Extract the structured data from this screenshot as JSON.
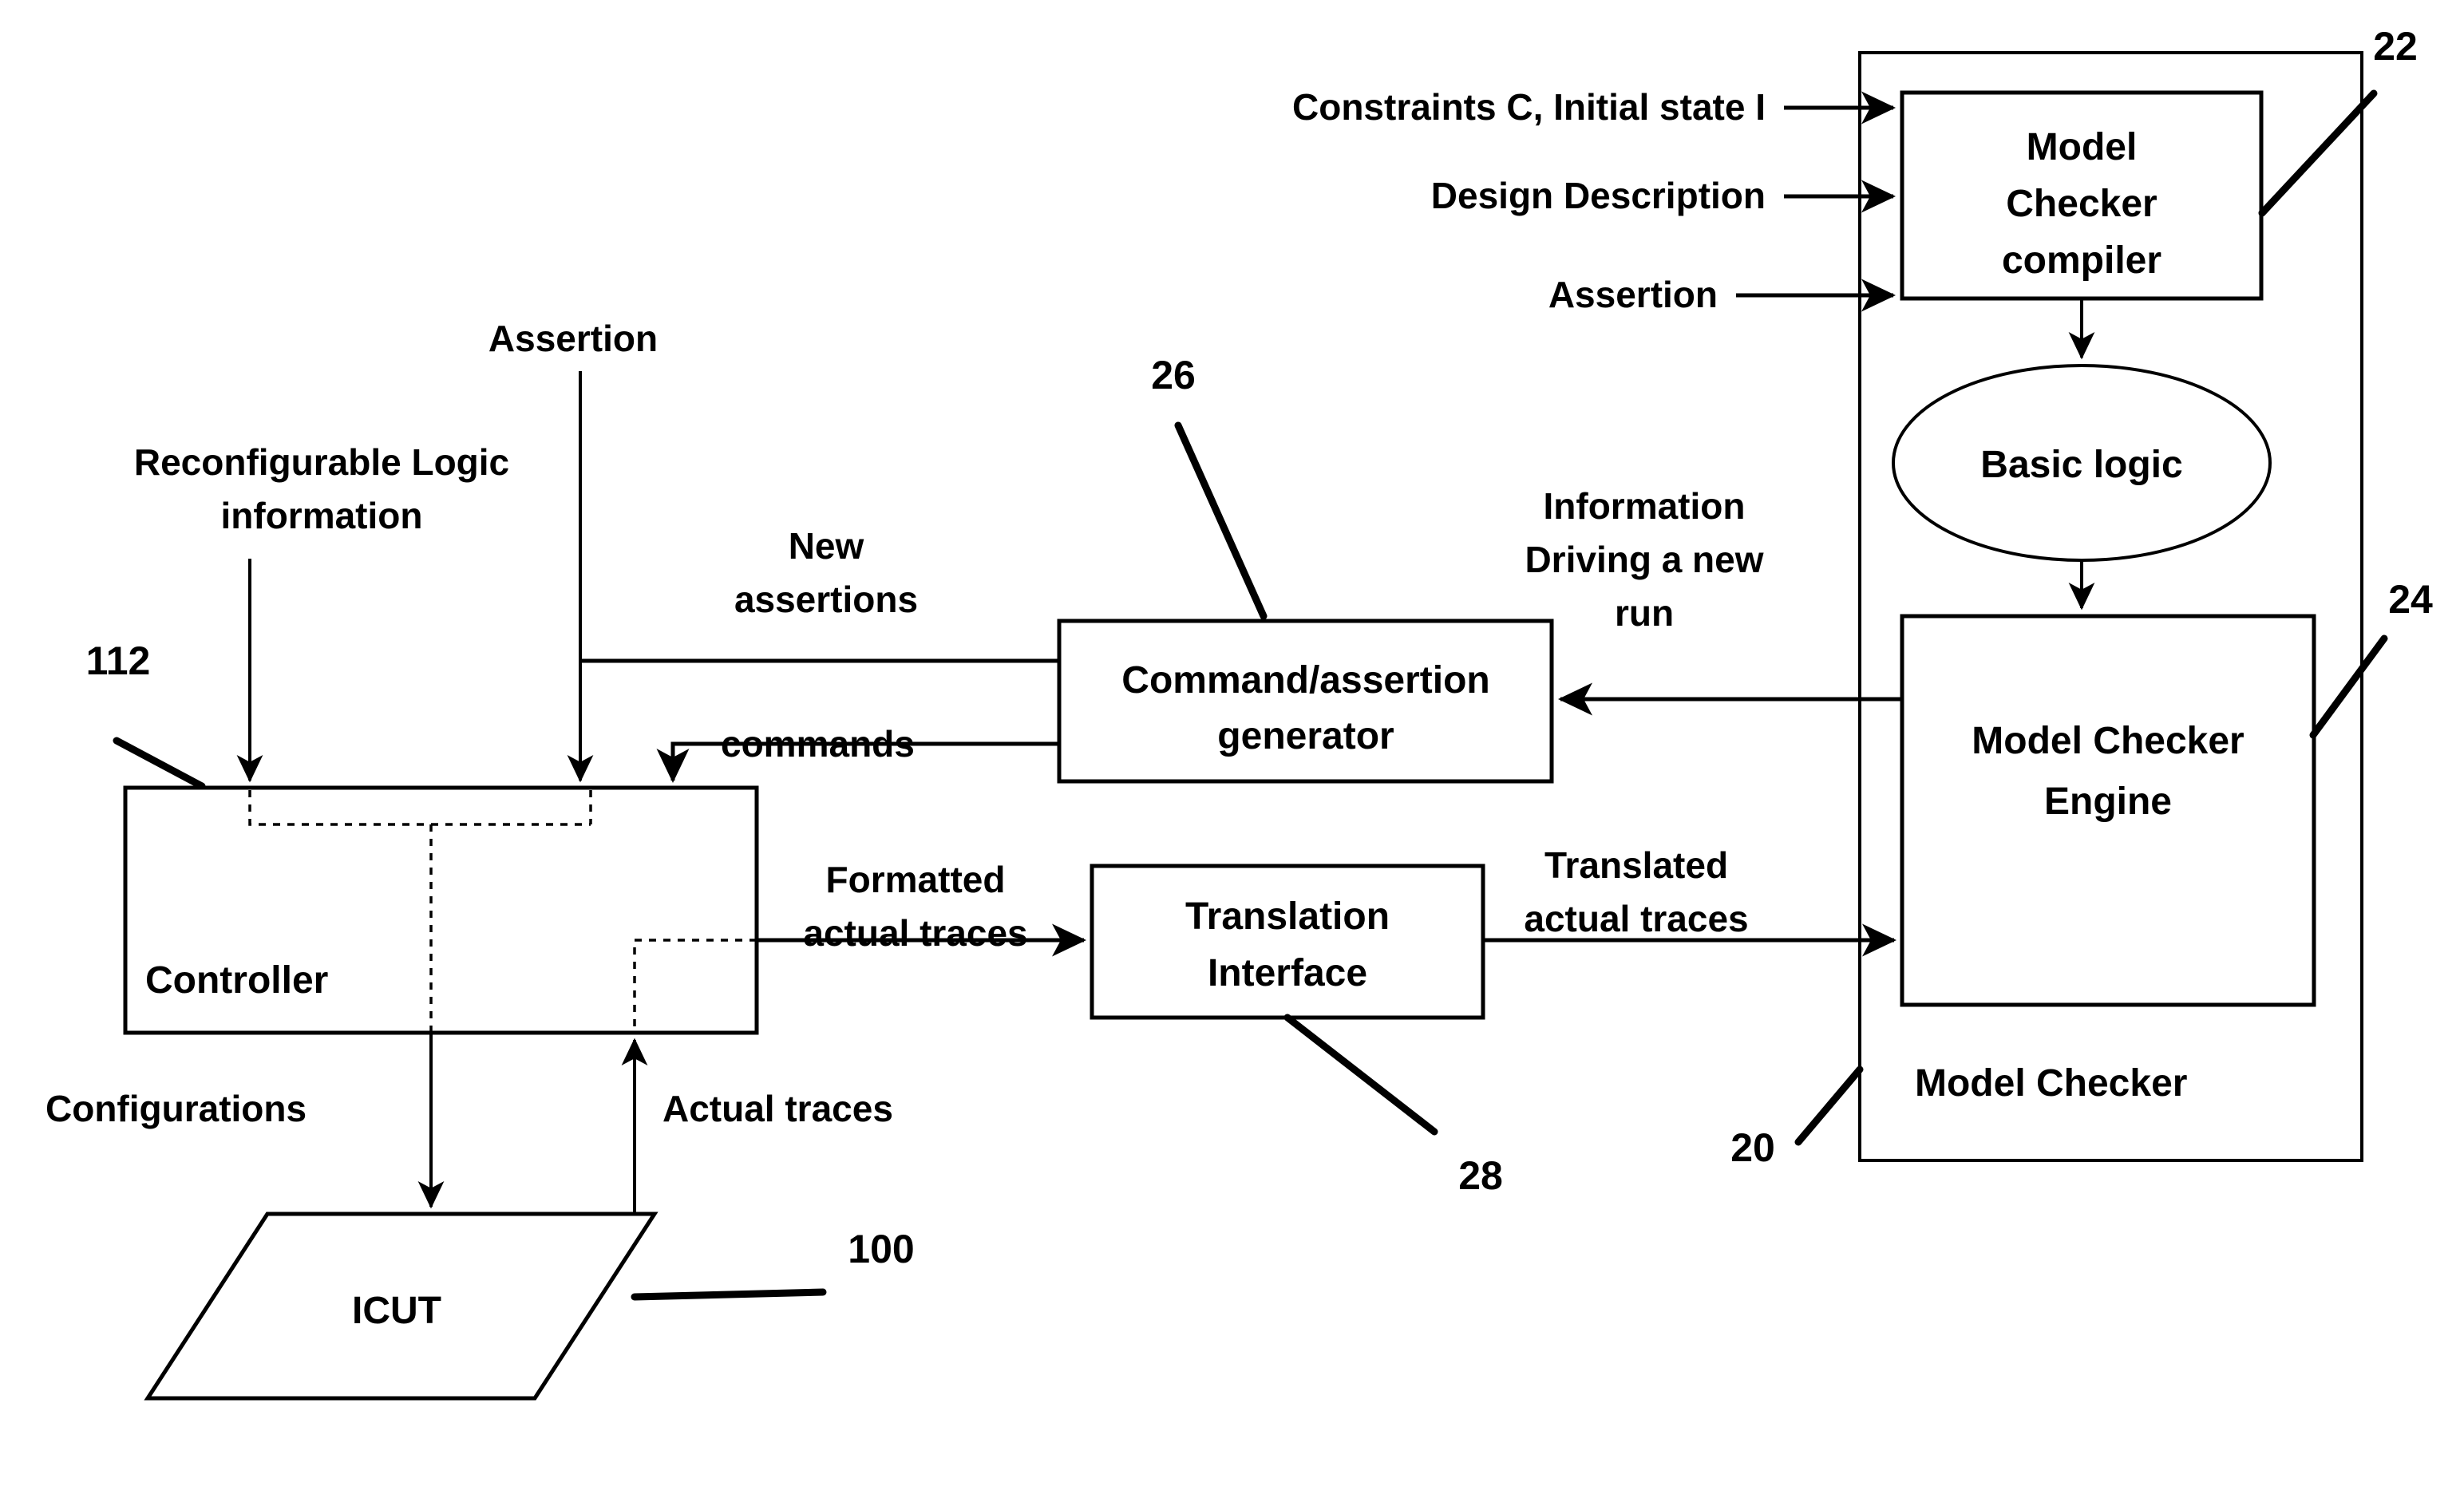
{
  "diagram": {
    "title": "Model checking system block diagram",
    "ink_color": "#000000",
    "background_color": "#ffffff"
  },
  "blocks": {
    "model_checker_compiler": "Model\nChecker\ncompiler",
    "model_checker_compiler_lines": [
      "Model",
      "Checker",
      "compiler"
    ],
    "basic_logic": "Basic logic",
    "model_checker_engine_lines": [
      "Model Checker",
      "Engine"
    ],
    "model_checker_group": "Model Checker",
    "command_assertion_generator_lines": [
      "Command/assertion",
      "generator"
    ],
    "translation_interface_lines": [
      "Translation",
      "Interface"
    ],
    "controller": "Controller",
    "icut": "ICUT"
  },
  "edge_labels": {
    "constraints_initial_state": "Constraints C, Initial state I",
    "design_description": "Design Description",
    "assertion_right": "Assertion",
    "assertion_left": "Assertion",
    "reconfigurable_logic_information_lines": [
      "Reconfigurable Logic",
      "information"
    ],
    "new_assertions_lines": [
      "New",
      "assertions"
    ],
    "commands": "commands",
    "information_driving_new_run_lines": [
      "Information",
      "Driving a new",
      "run"
    ],
    "formatted_actual_traces_lines": [
      "Formatted",
      "actual traces"
    ],
    "translated_actual_traces_lines": [
      "Translated",
      "actual traces"
    ],
    "configurations": "Configurations",
    "actual_traces": "Actual traces"
  },
  "reference_numerals": {
    "model_checker_group": "20",
    "model_checker_compiler": "22",
    "model_checker_engine": "24",
    "command_assertion_generator": "26",
    "translation_interface": "28",
    "icut": "100",
    "controller": "112"
  }
}
